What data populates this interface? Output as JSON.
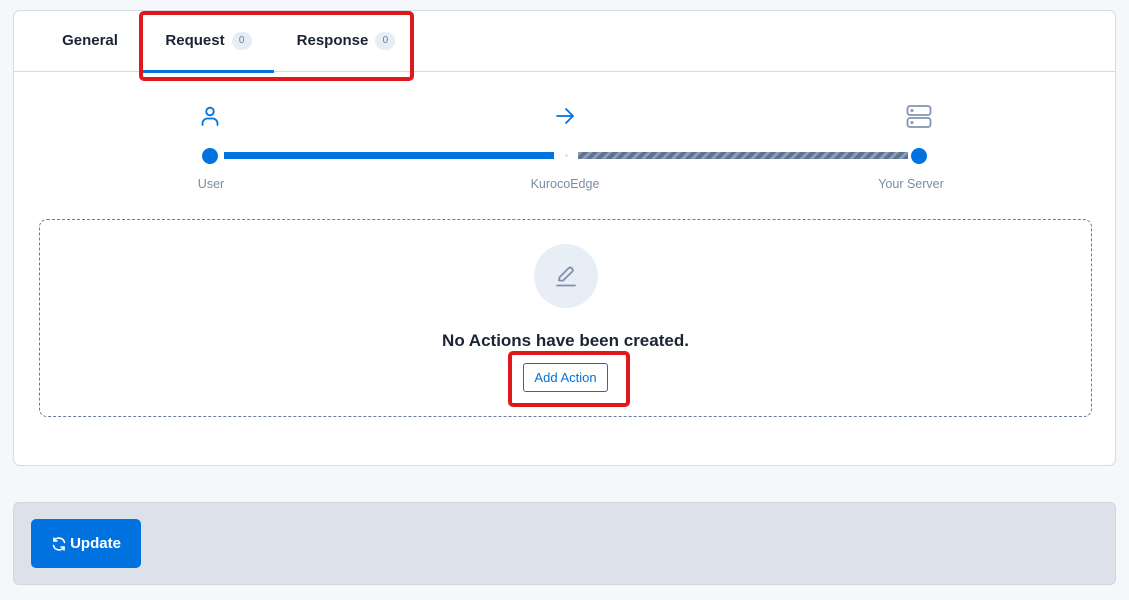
{
  "tabs": [
    {
      "label": "General",
      "active": false
    },
    {
      "label": "Request",
      "badge": "0",
      "active": true
    },
    {
      "label": "Response",
      "badge": "0",
      "active": false
    }
  ],
  "flow": {
    "nodes": [
      {
        "label": "User",
        "icon": "user-icon"
      },
      {
        "label": "KurocoEdge",
        "icon": "arrow-right-icon"
      },
      {
        "label": "Your Server",
        "icon": "server-icon"
      }
    ]
  },
  "empty_state": {
    "icon": "pencil-icon",
    "message": "No Actions have been created.",
    "button_label": "Add Action"
  },
  "footer": {
    "update_label": "Update",
    "update_icon": "refresh-icon"
  },
  "colors": {
    "accent": "#0073e0",
    "highlight": "#e0171b",
    "muted_text": "#7a8ba3"
  }
}
